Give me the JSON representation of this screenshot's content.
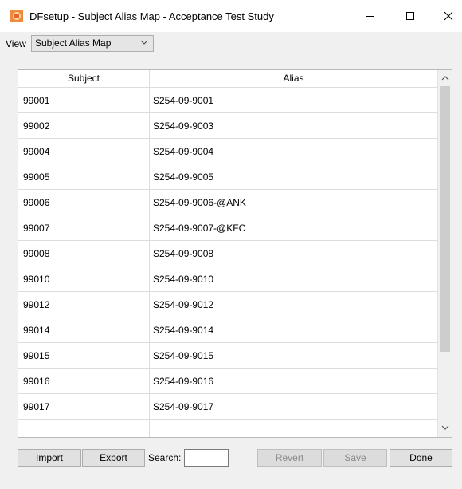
{
  "window": {
    "title": "DFsetup - Subject Alias Map - Acceptance Test Study",
    "controls": [
      "minimize-icon",
      "maximize-icon",
      "close-icon"
    ]
  },
  "view": {
    "label": "View",
    "selected": "Subject Alias Map"
  },
  "table": {
    "columns": [
      "Subject",
      "Alias"
    ],
    "rows": [
      {
        "subject": "99001",
        "alias": "S254-09-9001"
      },
      {
        "subject": "99002",
        "alias": "S254-09-9003"
      },
      {
        "subject": "99004",
        "alias": "S254-09-9004"
      },
      {
        "subject": "99005",
        "alias": "S254-09-9005"
      },
      {
        "subject": "99006",
        "alias": "S254-09-9006-@ANK"
      },
      {
        "subject": "99007",
        "alias": "S254-09-9007-@KFC"
      },
      {
        "subject": "99008",
        "alias": "S254-09-9008"
      },
      {
        "subject": "99010",
        "alias": "S254-09-9010"
      },
      {
        "subject": "99012",
        "alias": "S254-09-9012"
      },
      {
        "subject": "99014",
        "alias": "S254-09-9014"
      },
      {
        "subject": "99015",
        "alias": "S254-09-9015"
      },
      {
        "subject": "99016",
        "alias": "S254-09-9016"
      },
      {
        "subject": "99017",
        "alias": "S254-09-9017"
      },
      {
        "subject": "",
        "alias": ""
      }
    ],
    "scrollbar": {
      "thumb_fraction": 0.8
    }
  },
  "footer": {
    "import_label": "Import",
    "export_label": "Export",
    "search_label": "Search:",
    "search_value": "",
    "revert_label": "Revert",
    "save_label": "Save",
    "done_label": "Done"
  },
  "colors": {
    "window_bg": "#f0f0f0",
    "titlebar_bg": "#ffffff",
    "grid_line": "#dcdcdc",
    "disabled_text": "#8a8a8a",
    "app_icon": "#f08a3c"
  }
}
